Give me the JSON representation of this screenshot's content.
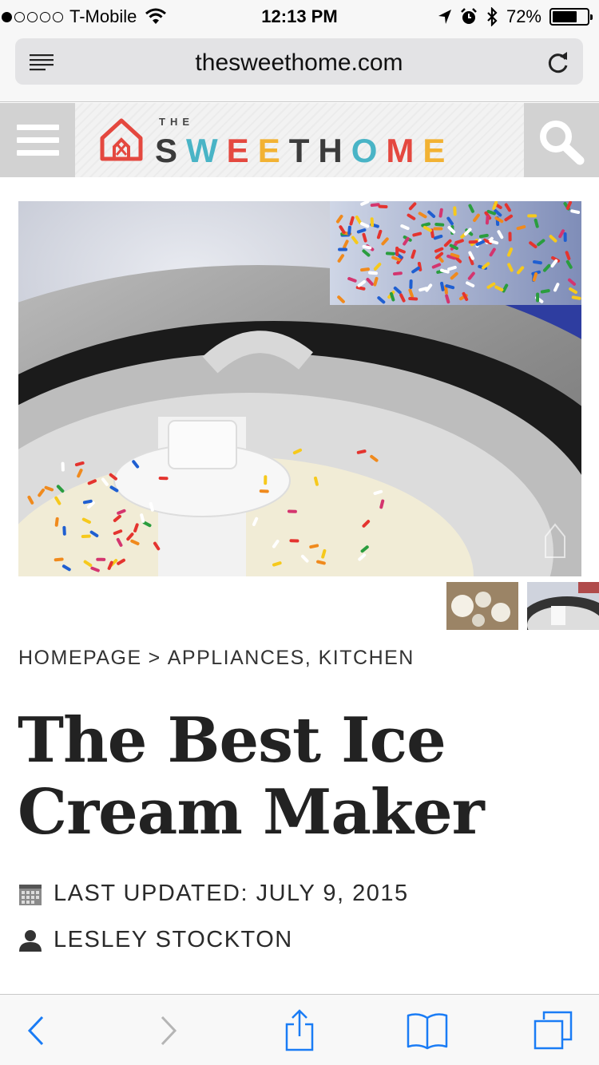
{
  "status_bar": {
    "carrier": "T-Mobile",
    "time": "12:13 PM",
    "battery_percent": "72%",
    "battery_level": 0.72,
    "signal_bars_filled": 1,
    "signal_bars_total": 5
  },
  "browser": {
    "url": "thesweethome.com",
    "icons": [
      "reader-icon",
      "reload-icon"
    ]
  },
  "site_header": {
    "logo_small": "THE",
    "logo_letters": [
      {
        "char": "S",
        "color": "#3b3b3b"
      },
      {
        "char": "W",
        "color": "#49b4c6"
      },
      {
        "char": "E",
        "color": "#e4483f"
      },
      {
        "char": "E",
        "color": "#f2b233"
      },
      {
        "char": "T",
        "color": "#3b3b3b"
      },
      {
        "char": "H",
        "color": "#3b3b3b"
      },
      {
        "char": "O",
        "color": "#49b4c6"
      },
      {
        "char": "M",
        "color": "#e4483f"
      },
      {
        "char": "E",
        "color": "#f2b233"
      }
    ],
    "icons": [
      "menu-icon",
      "house-logo-icon",
      "search-icon"
    ]
  },
  "article": {
    "breadcrumb": {
      "home": "HOMEPAGE",
      "separator": ">",
      "categories": "APPLIANCES, KITCHEN"
    },
    "title": "The Best Ice Cream Maker",
    "updated": "LAST UPDATED: JULY 9, 2015",
    "author": "LESLEY STOCKTON"
  },
  "toolbar": {
    "icons": [
      "back-icon",
      "forward-icon",
      "share-icon",
      "bookmarks-icon",
      "tabs-icon"
    ],
    "accent": "#1a7cf5",
    "disabled": "#b5b5b5"
  }
}
